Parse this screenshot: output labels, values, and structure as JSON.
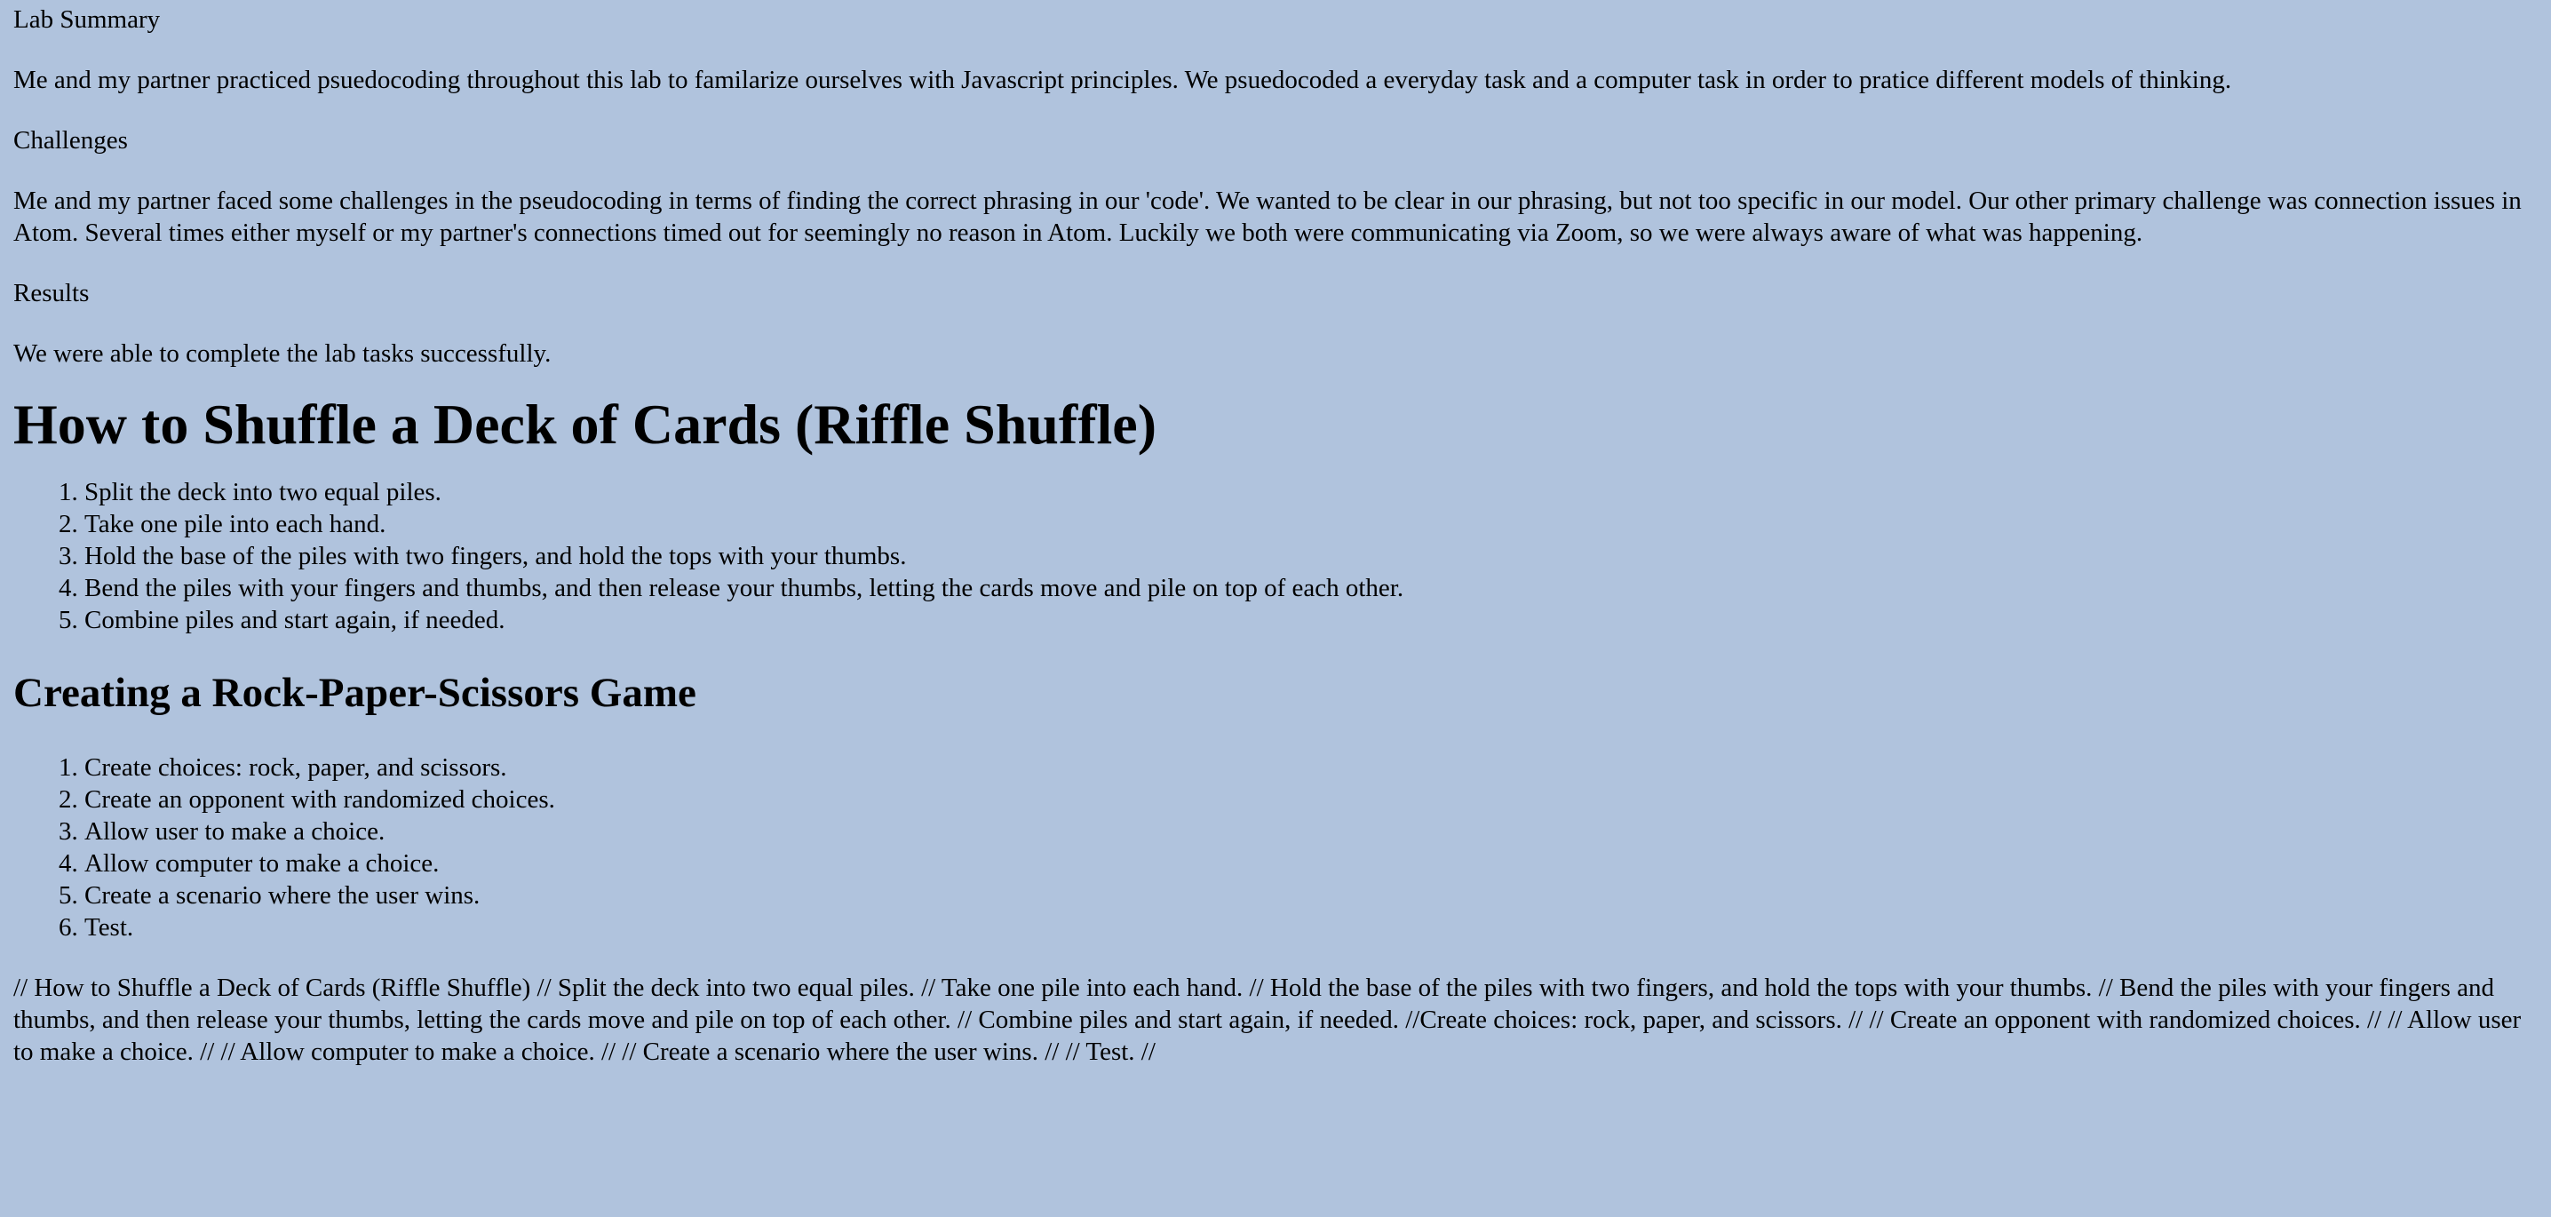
{
  "lab_summary": {
    "title": "Lab Summary",
    "text": "Me and my partner practiced psuedocoding throughout this lab to familarize ourselves with Javascript principles. We psuedocoded a everyday task and a computer task in order to pratice different models of thinking."
  },
  "challenges": {
    "title": "Challenges",
    "text": "Me and my partner faced some challenges in the pseudocoding in terms of finding the correct phrasing in our 'code'. We wanted to be clear in our phrasing, but not too specific in our model. Our other primary challenge was connection issues in Atom. Several times either myself or my partner's connections timed out for seemingly no reason in Atom. Luckily we both were communicating via Zoom, so we were always aware of what was happening."
  },
  "results": {
    "title": "Results",
    "text": "We were able to complete the lab tasks successfully."
  },
  "shuffle": {
    "heading": "How to Shuffle a Deck of Cards (Riffle Shuffle)",
    "steps": [
      "Split the deck into two equal piles.",
      "Take one pile into each hand.",
      "Hold the base of the piles with two fingers, and hold the tops with your thumbs.",
      "Bend the piles with your fingers and thumbs, and then release your thumbs, letting the cards move and pile on top of each other.",
      "Combine piles and start again, if needed."
    ]
  },
  "rps": {
    "heading": "Creating a Rock-Paper-Scissors Game",
    "steps": [
      "Create choices: rock, paper, and scissors.",
      "Create an opponent with randomized choices.",
      "Allow user to make a choice.",
      "Allow computer to make a choice.",
      "Create a scenario where the user wins.",
      "Test."
    ]
  },
  "comments": "// How to Shuffle a Deck of Cards (Riffle Shuffle) // Split the deck into two equal piles. // Take one pile into each hand. // Hold the base of the piles with two fingers, and hold the tops with your thumbs. // Bend the piles with your fingers and thumbs, and then release your thumbs, letting the cards move and pile on top of each other. // Combine piles and start again, if needed. //Create choices: rock, paper, and scissors. // // Create an opponent with randomized choices. // // Allow user to make a choice. // // Allow computer to make a choice. // // Create a scenario where the user wins. // // Test. //",
  "colors": {
    "page_background": "#b0c3dd",
    "text": "#000000"
  }
}
